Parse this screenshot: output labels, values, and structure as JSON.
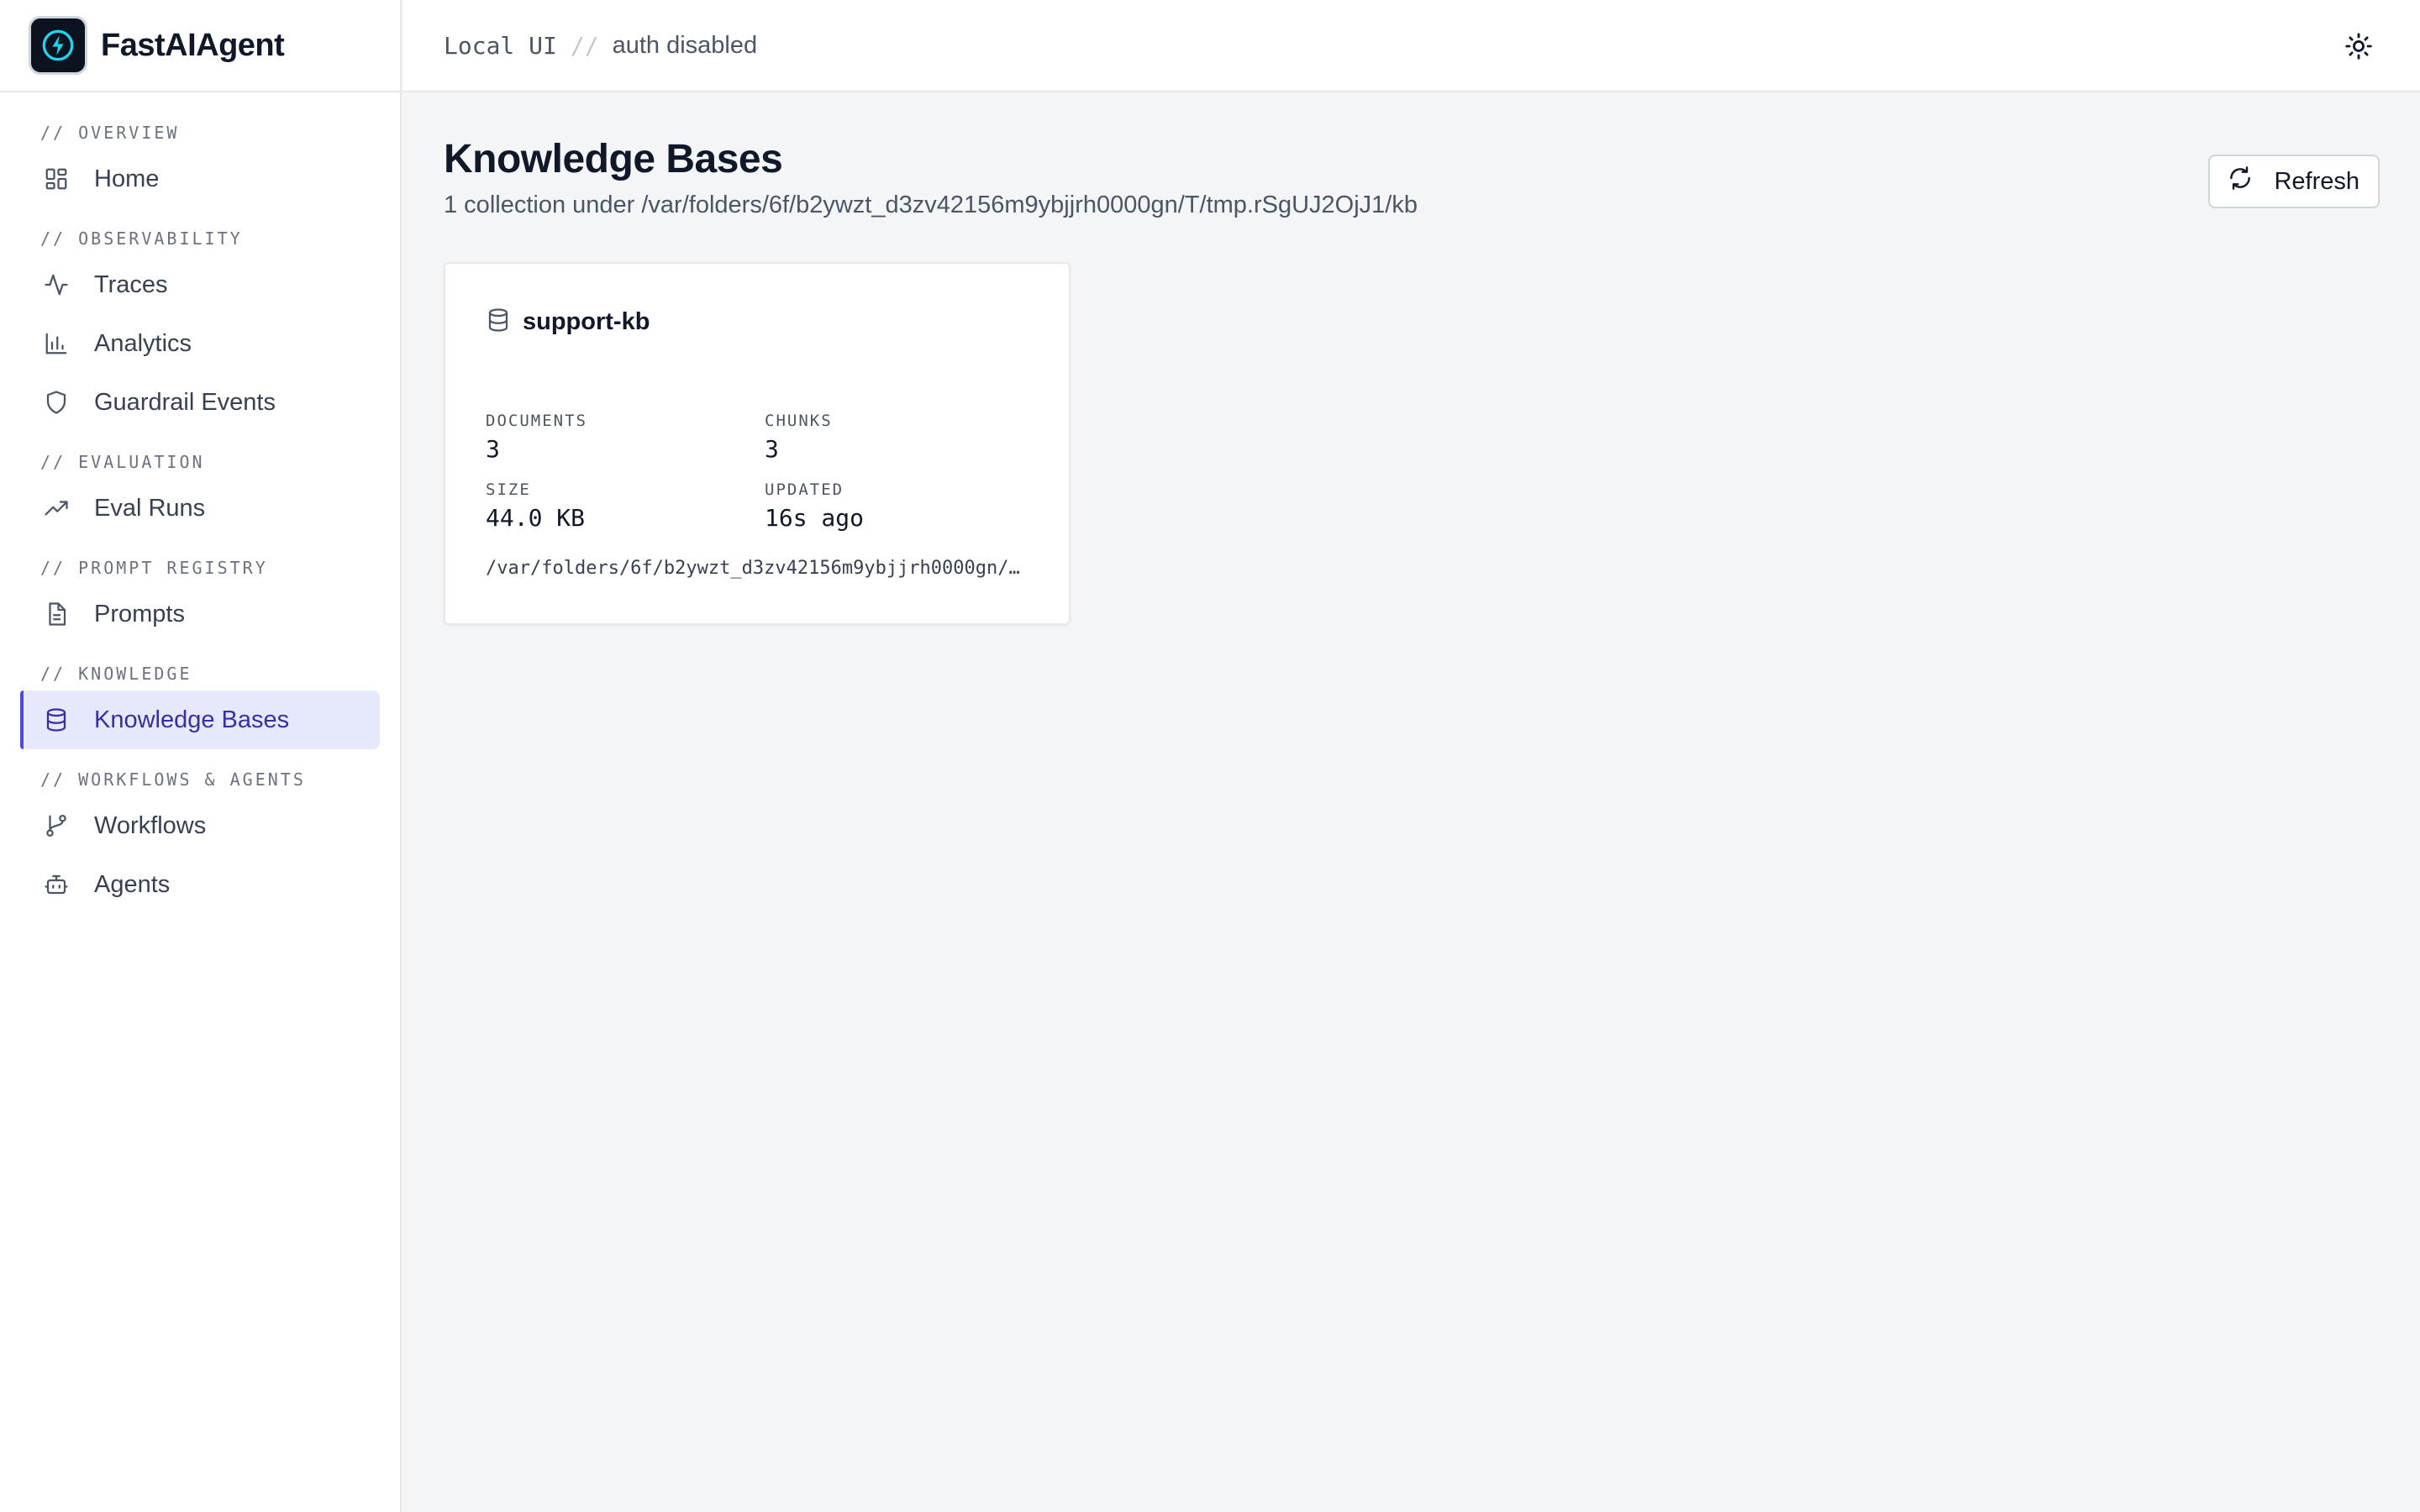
{
  "brand": {
    "name": "FastAIAgent",
    "logo_icon": "lightning-bolt-icon",
    "accent": "#4f46e5"
  },
  "topbar": {
    "mode": "Local UI",
    "separator": "//",
    "auth": "auth disabled",
    "theme_icon": "sun-icon"
  },
  "sidebar": {
    "sections": [
      {
        "label": "// OVERVIEW",
        "items": [
          {
            "label": "Home",
            "icon": "grid-icon"
          }
        ]
      },
      {
        "label": "// OBSERVABILITY",
        "items": [
          {
            "label": "Traces",
            "icon": "activity-icon"
          },
          {
            "label": "Analytics",
            "icon": "bar-chart-icon"
          },
          {
            "label": "Guardrail Events",
            "icon": "shield-icon"
          }
        ]
      },
      {
        "label": "// EVALUATION",
        "items": [
          {
            "label": "Eval Runs",
            "icon": "trending-up-icon"
          }
        ]
      },
      {
        "label": "// PROMPT REGISTRY",
        "items": [
          {
            "label": "Prompts",
            "icon": "document-icon"
          }
        ]
      },
      {
        "label": "// KNOWLEDGE",
        "items": [
          {
            "label": "Knowledge Bases",
            "icon": "database-icon",
            "active": true
          }
        ]
      },
      {
        "label": "// WORKFLOWS & AGENTS",
        "items": [
          {
            "label": "Workflows",
            "icon": "git-branch-icon"
          },
          {
            "label": "Agents",
            "icon": "bot-icon"
          }
        ]
      }
    ]
  },
  "main": {
    "title": "Knowledge Bases",
    "subtitle": "1 collection under /var/folders/6f/b2ywzt_d3zv42156m9ybjjrh0000gn/T/tmp.rSgUJ2OjJ1/kb",
    "refresh_label": "Refresh",
    "refresh_icon": "refresh-icon",
    "card": {
      "name": "support-kb",
      "icon": "database-icon",
      "stats": {
        "documents_label": "DOCUMENTS",
        "documents": "3",
        "chunks_label": "CHUNKS",
        "chunks": "3",
        "size_label": "SIZE",
        "size": "44.0 KB",
        "updated_label": "UPDATED",
        "updated": "16s ago"
      },
      "path": "/var/folders/6f/b2ywzt_d3zv42156m9ybjjrh0000gn/…"
    }
  }
}
